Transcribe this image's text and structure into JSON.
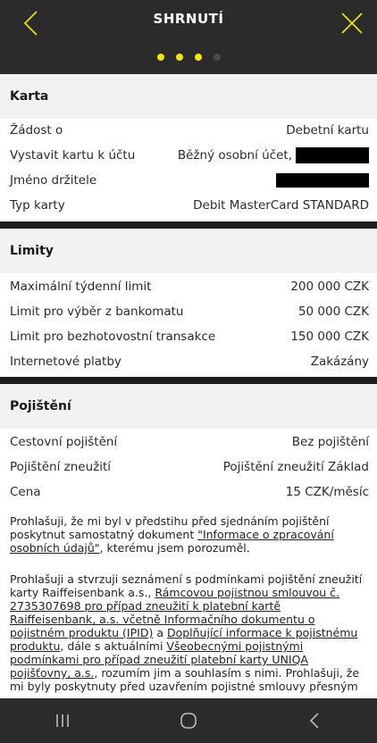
{
  "header": {
    "title": "SHRNUTÍ",
    "step_total": 4,
    "step_active": 3
  },
  "karta": {
    "title": "Karta",
    "rows": [
      {
        "label": "Žádost o",
        "value": "Debetní kartu"
      },
      {
        "label": "Vystavit kartu k účtu",
        "value": "Běžný osobní účet,"
      },
      {
        "label": "Jméno držitele",
        "value": ""
      },
      {
        "label": "Typ karty",
        "value": "Debit MasterCard STANDARD"
      }
    ]
  },
  "limity": {
    "title": "Limity",
    "rows": [
      {
        "label": "Maximální týdenní limit",
        "value": "200 000 CZK"
      },
      {
        "label": "Limit pro výběr z bankomatu",
        "value": "50 000 CZK"
      },
      {
        "label": "Limit pro bezhotovostní transakce",
        "value": "150 000 CZK"
      },
      {
        "label": "Internetové platby",
        "value": "Zakázány"
      }
    ]
  },
  "pojisteni": {
    "title": "Pojištění",
    "rows": [
      {
        "label": "Cestovní pojištění",
        "value": "Bez pojištění"
      },
      {
        "label": "Pojištění zneužití",
        "value": "Pojištění zneužití Základ"
      },
      {
        "label": "Cena",
        "value": "15 CZK/měsíc"
      }
    ]
  },
  "para1": {
    "before": "Prohlašuji, že mi byl v předstihu před sjednáním pojištění poskytnut samostatný dokument ",
    "link": "\"Informace o zpracování osobních údajů\"",
    "after": ", kterému jsem porozuměl."
  },
  "para2": {
    "t1": "Prohlašuji a stvrzuji seznámení s podmínkami pojištění zneužití karty Raiffeisenbank a.s., ",
    "l1": "Rámcovou pojistnou smlouvou č. 2735307698 pro případ zneužití k platební kartě Raiffeisenbank, a.s. včetně Informačního dokumentu o pojistném produktu (IPID)",
    "t2": " a ",
    "l2": "Doplňující informace k pojistnému produktu",
    "t3": ", dále s aktuálními ",
    "l3": "Všeobecnými pojistnými podmínkami pro případ zneužití platební karty UNIQA pojišťovny, a.s.",
    "t4": ", rozumím jim a souhlasím s nimi. Prohlašuji, že mi byly poskytnuty před uzavřením pojistné smlouvy přesným"
  },
  "colors": {
    "accent": "#f5e800",
    "dark": "#2b2b2b",
    "section_bg": "#f2f2f2"
  },
  "icons": {
    "back": "chevron-left-icon",
    "close": "close-icon"
  }
}
